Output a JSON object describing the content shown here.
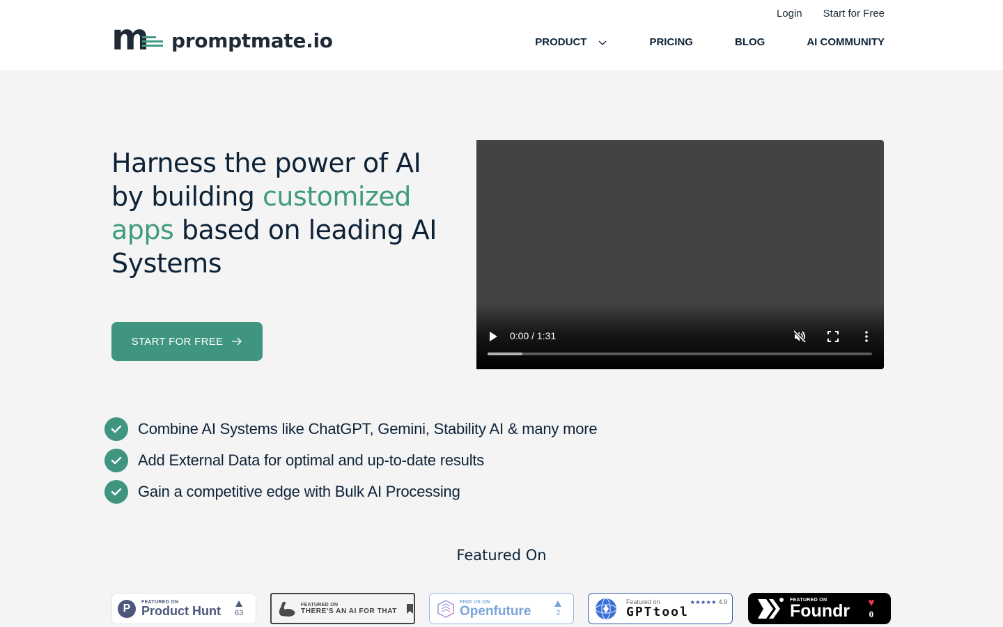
{
  "header": {
    "brand": "promptmate.io",
    "brand_colors": {
      "dark": "#1f2a36",
      "accent": "#3f9a7f"
    },
    "top_links": [
      {
        "label": "Login"
      },
      {
        "label": "Start for Free"
      }
    ],
    "nav": [
      {
        "label": "PRODUCT",
        "has_dropdown": true
      },
      {
        "label": "PRICING"
      },
      {
        "label": "BLOG"
      },
      {
        "label": "AI COMMUNITY"
      }
    ]
  },
  "hero": {
    "title_part1": "Harness the power of AI by building ",
    "title_accent": "customized apps",
    "title_part2": " based on leading AI Systems",
    "cta_label": "START FOR FREE",
    "accent_color": "#3f9580"
  },
  "video": {
    "time_display": "0:00 / 1:31",
    "buffered_fraction": 0.09,
    "muted": true
  },
  "features": [
    {
      "text": "Combine AI Systems like ChatGPT, Gemini, Stability AI & many more"
    },
    {
      "text": "Add External Data for optimal and up-to-date results"
    },
    {
      "text": "Gain a competitive edge with Bulk AI Processing"
    }
  ],
  "featured": {
    "title": "Featured On",
    "badges": [
      {
        "name": "Product Hunt",
        "kicker": "FEATURED ON",
        "count": "63"
      },
      {
        "name": "THERE'S AN AI FOR THAT",
        "kicker": "FEATURED ON"
      },
      {
        "name": "Openfuture",
        "kicker": "FIND US ON",
        "count": "2"
      },
      {
        "name": "GPTtool",
        "kicker": "Featured on",
        "stars": "★★★★★",
        "rating": "4.9"
      },
      {
        "name": "Foundr",
        "kicker": "FEATURED ON",
        "count": "0"
      }
    ]
  }
}
